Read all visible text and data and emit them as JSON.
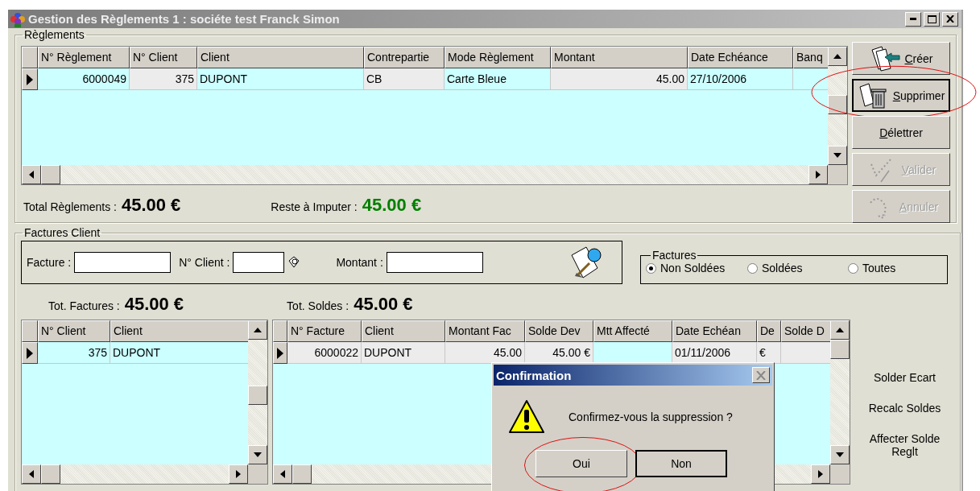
{
  "window": {
    "title": "Gestion des Règlements 1 : sociéte test Franck Simon"
  },
  "reglements": {
    "legend": "Règlements",
    "grid": {
      "columns": [
        "N° Règlement",
        "N° Client",
        "Client",
        "Contrepartie",
        "Mode Règlement",
        "Montant",
        "Date Echéance",
        "Banq"
      ],
      "rows": [
        {
          "selected": true,
          "cells": [
            "6000049",
            "375",
            "DUPONT",
            "CB",
            "Carte Bleue",
            "45.00",
            "27/10/2006",
            null
          ]
        }
      ]
    },
    "total_label": "Total Règlements :",
    "total_value": "45.00 €",
    "reste_label": "Reste à Imputer :",
    "reste_value": "45.00 €",
    "actions": [
      {
        "label": "Créer",
        "kind": "create",
        "disabled": false,
        "highlighted": false
      },
      {
        "label": "Supprimer",
        "kind": "delete",
        "disabled": false,
        "highlighted": true
      },
      {
        "label": "Délettrer",
        "kind": "plain",
        "disabled": false,
        "highlighted": false
      },
      {
        "label": "Valider",
        "kind": "validate",
        "disabled": true,
        "highlighted": false
      },
      {
        "label": "Annuler",
        "kind": "cancel",
        "disabled": true,
        "highlighted": false
      }
    ]
  },
  "factures": {
    "legend": "Factures Client",
    "filters": [
      {
        "label": "Facture :"
      },
      {
        "label": "N° Client :"
      },
      {
        "label": "Montant :"
      }
    ],
    "radio_group": {
      "legend": "Factures",
      "options": [
        {
          "label": "Non Soldées",
          "selected": true
        },
        {
          "label": "Soldées",
          "selected": false
        },
        {
          "label": "Toutes",
          "selected": false
        }
      ]
    },
    "tot_factures_label": "Tot. Factures :",
    "tot_factures_value": "45.00 €",
    "tot_soldes_label": "Tot. Soldes :",
    "tot_soldes_value": "45.00 €",
    "clients_grid": {
      "columns": [
        "N° Client",
        "Client"
      ],
      "rows": [
        {
          "selected": true,
          "cells": [
            "375",
            "DUPONT"
          ]
        }
      ]
    },
    "invoices_grid": {
      "columns": [
        "N° Facture",
        "Client",
        "Montant Fac",
        "Solde Dev",
        "Mtt Affecté",
        "Date Echéan",
        "De",
        "Solde D"
      ],
      "rows": [
        {
          "selected": true,
          "cells": [
            "6000022",
            "DUPONT",
            "45.00",
            "45.00 €",
            null,
            "01/11/2006",
            "€",
            null
          ]
        }
      ]
    },
    "side_actions": [
      "Solder Ecart",
      "Recalc Soldes",
      "Affecter Solde Reglt"
    ]
  },
  "dialog": {
    "title": "Confirmation",
    "message": "Confirmez-vous la suppression ?",
    "buttons": [
      {
        "label": "Oui",
        "default": false,
        "highlighted": true
      },
      {
        "label": "Non",
        "default": true,
        "highlighted": false
      }
    ]
  }
}
